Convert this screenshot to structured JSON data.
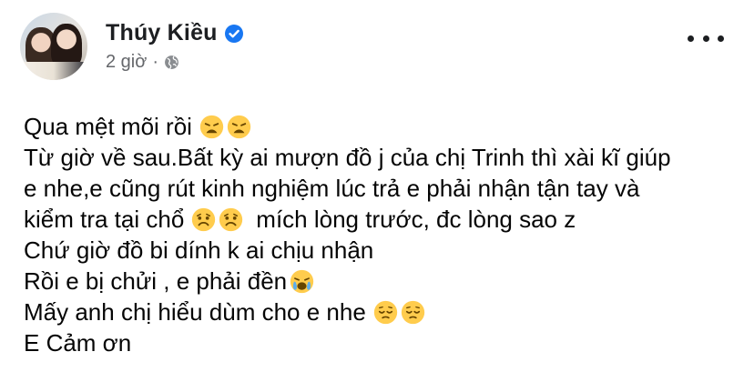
{
  "post": {
    "author": "Thúy Kiều",
    "time": "2 giờ",
    "separator": "·",
    "privacy_icon": "globe-icon",
    "verified_icon": "verified-badge-icon",
    "more_icon": "more-options-icon",
    "accent_color": "#1877f2",
    "muted_color": "#65676b"
  },
  "lines": [
    {
      "text": "Qua mệt mõi rồi",
      "emojis": [
        "weary-face",
        "weary-face"
      ],
      "after": ""
    },
    {
      "text": "Từ giờ về sau.Bất kỳ ai mượn đồ j của chị Trinh thì xài kĩ giúp",
      "emojis": [],
      "after": ""
    },
    {
      "text": "e nhe,e cũng rút kinh nghiệm lúc trả e phải nhận tận tay và",
      "emojis": [],
      "after": ""
    },
    {
      "text": "kiểm tra tại chổ",
      "emojis": [
        "sad-face",
        "sad-face"
      ],
      "after": "mích lòng trước, đc lòng sao z"
    },
    {
      "text": "Chứ giờ đồ bi dính k ai chịu nhận",
      "emojis": [],
      "after": ""
    },
    {
      "text": "Rồi e bị chửi , e phải đền",
      "emojis": [
        "crying-face"
      ],
      "after": ""
    },
    {
      "text": "Mấy anh chị hiểu dùm cho e nhe",
      "emojis": [
        "pensive-face",
        "pensive-face"
      ],
      "after": ""
    },
    {
      "text": "E Cảm ơn",
      "emojis": [],
      "after": ""
    }
  ]
}
